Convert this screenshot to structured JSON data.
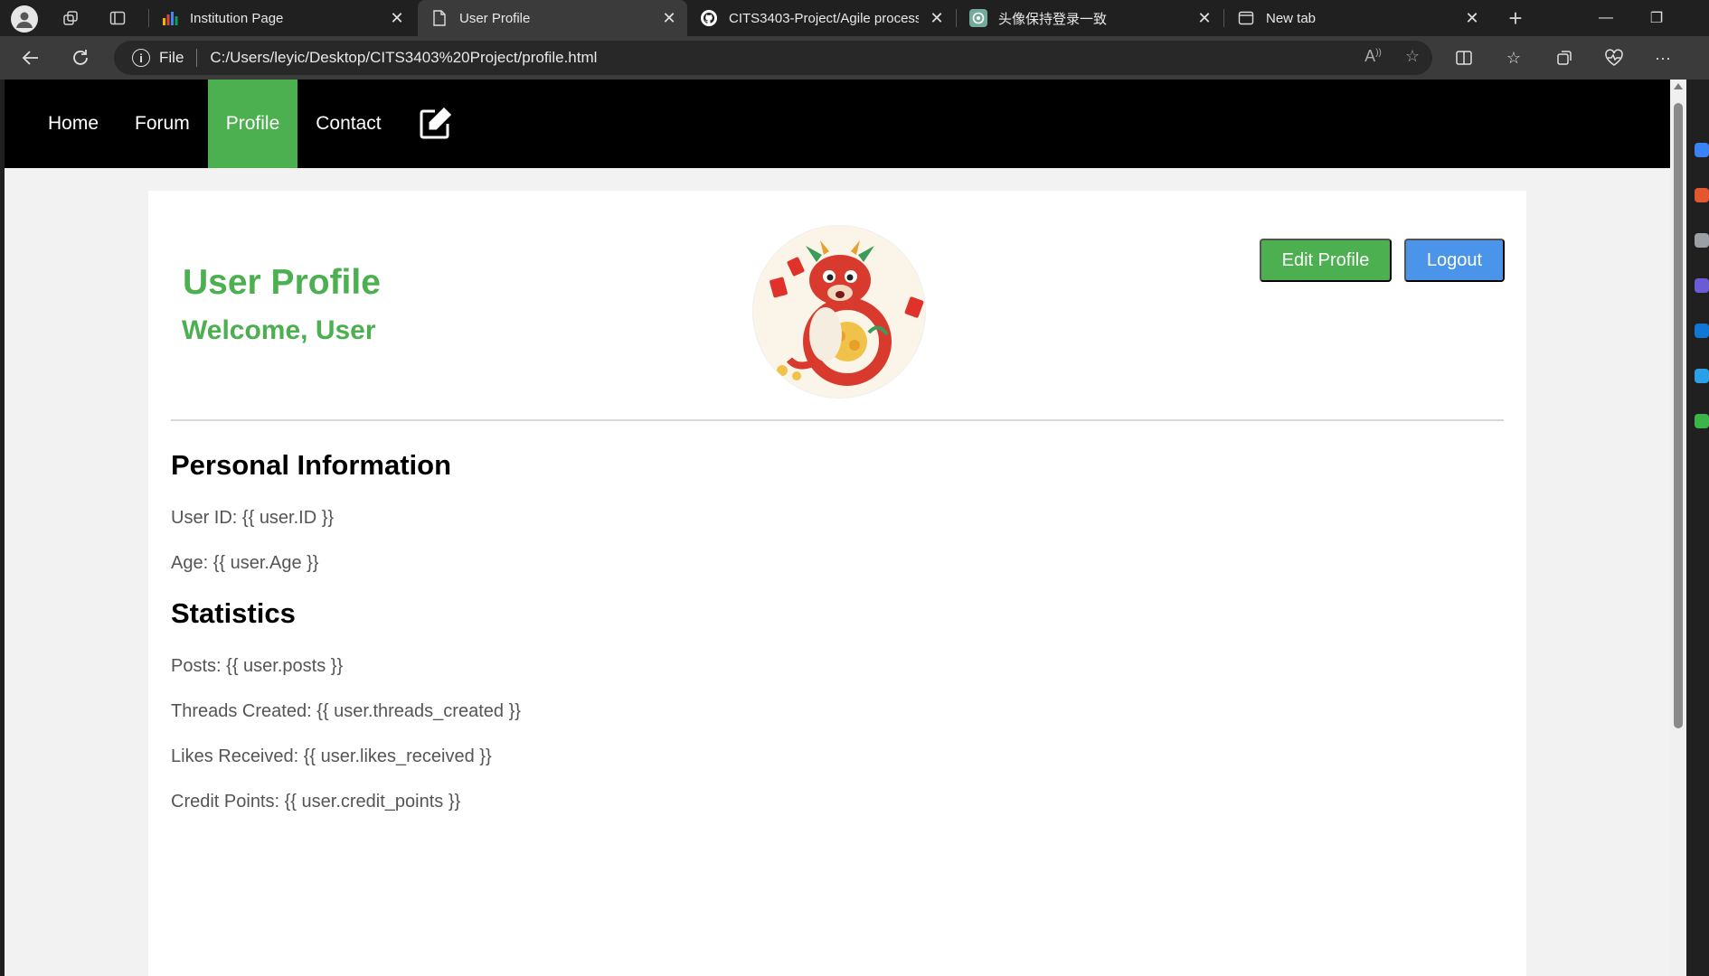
{
  "browser": {
    "tabs": [
      {
        "title": "Institution Page",
        "favicon": "bar-chart-icon"
      },
      {
        "title": "User Profile",
        "favicon": "document-icon",
        "active": true
      },
      {
        "title": "CITS3403-Project/Agile processes",
        "favicon": "github-icon"
      },
      {
        "title": "头像保持登录一致",
        "favicon": "chatgpt-icon"
      },
      {
        "title": "New tab",
        "favicon": "new-tab-icon"
      }
    ],
    "address": {
      "scheme": "File",
      "url": "C:/Users/leyic/Desktop/CITS3403%20Project/profile.html"
    }
  },
  "nav": {
    "home": "Home",
    "forum": "Forum",
    "profile": "Profile",
    "contact": "Contact"
  },
  "profile": {
    "title": "User Profile",
    "welcome": "Welcome, User",
    "edit_button": "Edit Profile",
    "logout_button": "Logout",
    "personal_heading": "Personal Information",
    "user_id": "User ID: {{ user.ID }}",
    "age": "Age: {{ user.Age }}",
    "stats_heading": "Statistics",
    "posts": "Posts: {{ user.posts }}",
    "threads": "Threads Created: {{ user.threads_created }}",
    "likes": "Likes Received: {{ user.likes_received }}",
    "credits": "Credit Points: {{ user.credit_points }}"
  },
  "colors": {
    "accent_green": "#4caf50",
    "logout_blue": "#4a94e9",
    "nav_bg": "#000000",
    "page_bg": "#f2f2f2"
  }
}
